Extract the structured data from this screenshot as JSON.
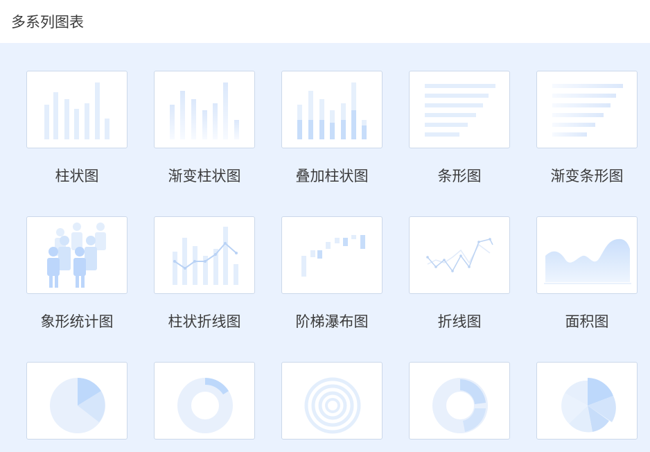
{
  "header": {
    "title": "多系列图表"
  },
  "charts": [
    {
      "label": "柱状图",
      "icon": "bar-chart-icon"
    },
    {
      "label": "渐变柱状图",
      "icon": "gradient-bar-chart-icon"
    },
    {
      "label": "叠加柱状图",
      "icon": "stacked-bar-chart-icon"
    },
    {
      "label": "条形图",
      "icon": "horizontal-bar-chart-icon"
    },
    {
      "label": "渐变条形图",
      "icon": "gradient-horizontal-bar-chart-icon"
    },
    {
      "label": "象形统计图",
      "icon": "pictograph-chart-icon"
    },
    {
      "label": "柱状折线图",
      "icon": "bar-line-chart-icon"
    },
    {
      "label": "阶梯瀑布图",
      "icon": "waterfall-chart-icon"
    },
    {
      "label": "折线图",
      "icon": "line-chart-icon"
    },
    {
      "label": "面积图",
      "icon": "area-chart-icon"
    },
    {
      "label": "",
      "icon": "pie-chart-icon"
    },
    {
      "label": "",
      "icon": "donut-chart-icon"
    },
    {
      "label": "",
      "icon": "concentric-ring-chart-icon"
    },
    {
      "label": "",
      "icon": "segmented-donut-chart-icon"
    },
    {
      "label": "",
      "icon": "rose-pie-chart-icon"
    }
  ],
  "colors": {
    "accent": "#b9d6fb",
    "light": "#e6f0fc",
    "border": "#cbd8ea",
    "background": "#eaf2fe"
  }
}
